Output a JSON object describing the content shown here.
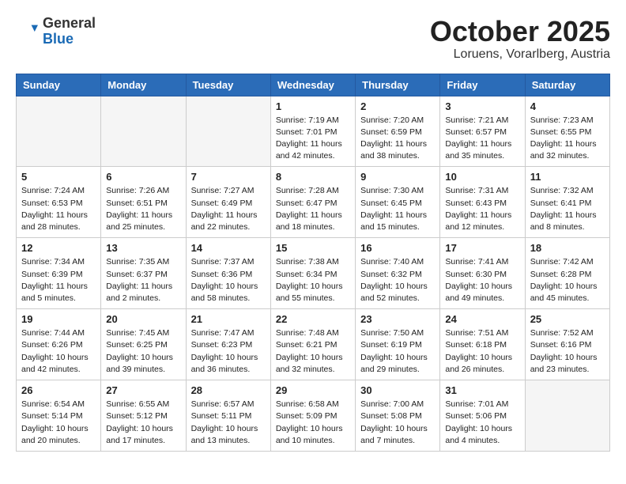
{
  "header": {
    "logo_general": "General",
    "logo_blue": "Blue",
    "month_title": "October 2025",
    "location": "Loruens, Vorarlberg, Austria"
  },
  "days_of_week": [
    "Sunday",
    "Monday",
    "Tuesday",
    "Wednesday",
    "Thursday",
    "Friday",
    "Saturday"
  ],
  "weeks": [
    [
      {
        "day": "",
        "info": ""
      },
      {
        "day": "",
        "info": ""
      },
      {
        "day": "",
        "info": ""
      },
      {
        "day": "1",
        "info": "Sunrise: 7:19 AM\nSunset: 7:01 PM\nDaylight: 11 hours\nand 42 minutes."
      },
      {
        "day": "2",
        "info": "Sunrise: 7:20 AM\nSunset: 6:59 PM\nDaylight: 11 hours\nand 38 minutes."
      },
      {
        "day": "3",
        "info": "Sunrise: 7:21 AM\nSunset: 6:57 PM\nDaylight: 11 hours\nand 35 minutes."
      },
      {
        "day": "4",
        "info": "Sunrise: 7:23 AM\nSunset: 6:55 PM\nDaylight: 11 hours\nand 32 minutes."
      }
    ],
    [
      {
        "day": "5",
        "info": "Sunrise: 7:24 AM\nSunset: 6:53 PM\nDaylight: 11 hours\nand 28 minutes."
      },
      {
        "day": "6",
        "info": "Sunrise: 7:26 AM\nSunset: 6:51 PM\nDaylight: 11 hours\nand 25 minutes."
      },
      {
        "day": "7",
        "info": "Sunrise: 7:27 AM\nSunset: 6:49 PM\nDaylight: 11 hours\nand 22 minutes."
      },
      {
        "day": "8",
        "info": "Sunrise: 7:28 AM\nSunset: 6:47 PM\nDaylight: 11 hours\nand 18 minutes."
      },
      {
        "day": "9",
        "info": "Sunrise: 7:30 AM\nSunset: 6:45 PM\nDaylight: 11 hours\nand 15 minutes."
      },
      {
        "day": "10",
        "info": "Sunrise: 7:31 AM\nSunset: 6:43 PM\nDaylight: 11 hours\nand 12 minutes."
      },
      {
        "day": "11",
        "info": "Sunrise: 7:32 AM\nSunset: 6:41 PM\nDaylight: 11 hours\nand 8 minutes."
      }
    ],
    [
      {
        "day": "12",
        "info": "Sunrise: 7:34 AM\nSunset: 6:39 PM\nDaylight: 11 hours\nand 5 minutes."
      },
      {
        "day": "13",
        "info": "Sunrise: 7:35 AM\nSunset: 6:37 PM\nDaylight: 11 hours\nand 2 minutes."
      },
      {
        "day": "14",
        "info": "Sunrise: 7:37 AM\nSunset: 6:36 PM\nDaylight: 10 hours\nand 58 minutes."
      },
      {
        "day": "15",
        "info": "Sunrise: 7:38 AM\nSunset: 6:34 PM\nDaylight: 10 hours\nand 55 minutes."
      },
      {
        "day": "16",
        "info": "Sunrise: 7:40 AM\nSunset: 6:32 PM\nDaylight: 10 hours\nand 52 minutes."
      },
      {
        "day": "17",
        "info": "Sunrise: 7:41 AM\nSunset: 6:30 PM\nDaylight: 10 hours\nand 49 minutes."
      },
      {
        "day": "18",
        "info": "Sunrise: 7:42 AM\nSunset: 6:28 PM\nDaylight: 10 hours\nand 45 minutes."
      }
    ],
    [
      {
        "day": "19",
        "info": "Sunrise: 7:44 AM\nSunset: 6:26 PM\nDaylight: 10 hours\nand 42 minutes."
      },
      {
        "day": "20",
        "info": "Sunrise: 7:45 AM\nSunset: 6:25 PM\nDaylight: 10 hours\nand 39 minutes."
      },
      {
        "day": "21",
        "info": "Sunrise: 7:47 AM\nSunset: 6:23 PM\nDaylight: 10 hours\nand 36 minutes."
      },
      {
        "day": "22",
        "info": "Sunrise: 7:48 AM\nSunset: 6:21 PM\nDaylight: 10 hours\nand 32 minutes."
      },
      {
        "day": "23",
        "info": "Sunrise: 7:50 AM\nSunset: 6:19 PM\nDaylight: 10 hours\nand 29 minutes."
      },
      {
        "day": "24",
        "info": "Sunrise: 7:51 AM\nSunset: 6:18 PM\nDaylight: 10 hours\nand 26 minutes."
      },
      {
        "day": "25",
        "info": "Sunrise: 7:52 AM\nSunset: 6:16 PM\nDaylight: 10 hours\nand 23 minutes."
      }
    ],
    [
      {
        "day": "26",
        "info": "Sunrise: 6:54 AM\nSunset: 5:14 PM\nDaylight: 10 hours\nand 20 minutes."
      },
      {
        "day": "27",
        "info": "Sunrise: 6:55 AM\nSunset: 5:12 PM\nDaylight: 10 hours\nand 17 minutes."
      },
      {
        "day": "28",
        "info": "Sunrise: 6:57 AM\nSunset: 5:11 PM\nDaylight: 10 hours\nand 13 minutes."
      },
      {
        "day": "29",
        "info": "Sunrise: 6:58 AM\nSunset: 5:09 PM\nDaylight: 10 hours\nand 10 minutes."
      },
      {
        "day": "30",
        "info": "Sunrise: 7:00 AM\nSunset: 5:08 PM\nDaylight: 10 hours\nand 7 minutes."
      },
      {
        "day": "31",
        "info": "Sunrise: 7:01 AM\nSunset: 5:06 PM\nDaylight: 10 hours\nand 4 minutes."
      },
      {
        "day": "",
        "info": ""
      }
    ]
  ]
}
